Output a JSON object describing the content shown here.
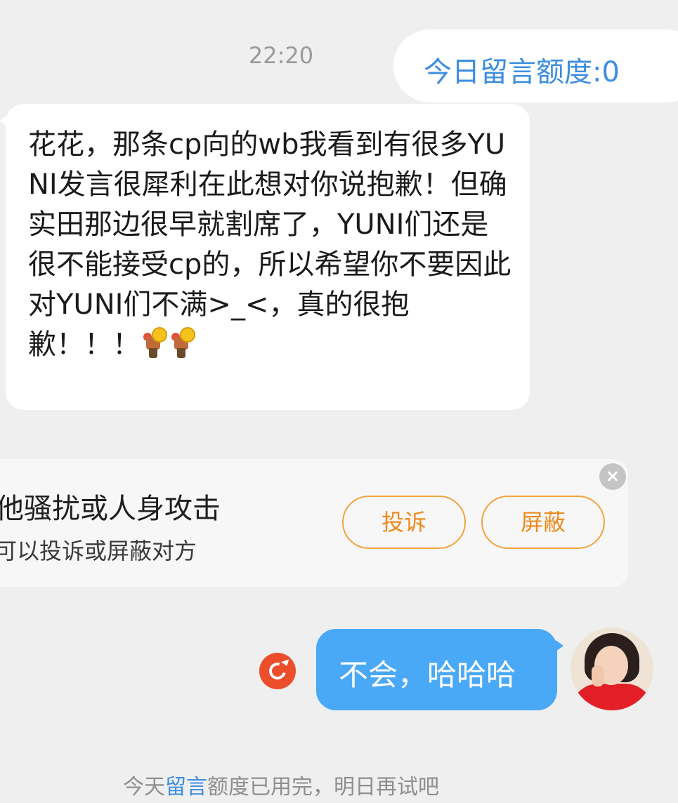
{
  "timestamp": "22:20",
  "quota": {
    "text": "今日留言额度:0"
  },
  "incoming_message": {
    "text": "花花，那条cp向的wb我看到有很多YUNI发言很犀利在此想对你说抱歉！但确实田那边很早就割席了，YUNI们还是很不能接受cp的，所以希望你不要因此对YUNI们不满>_<，真的很抱歉！！！",
    "emojis": [
      "emoji-character-icon",
      "emoji-character-icon"
    ]
  },
  "report_card": {
    "title": "他骚扰或人身攻击",
    "subtitle": "可以投诉或屏蔽对方",
    "report_label": "投诉",
    "block_label": "屏蔽"
  },
  "outgoing_message": {
    "text": "不会，哈哈哈"
  },
  "system_notice": {
    "prefix": "今天",
    "link": "留言",
    "suffix": "额度已用完，明日再试吧"
  },
  "colors": {
    "background": "#efefef",
    "accent_blue": "#3c8ee0",
    "outgoing_bubble": "#4aa9f6",
    "warning_orange": "#ee8a1c",
    "retry_red": "#ec4d2a"
  }
}
